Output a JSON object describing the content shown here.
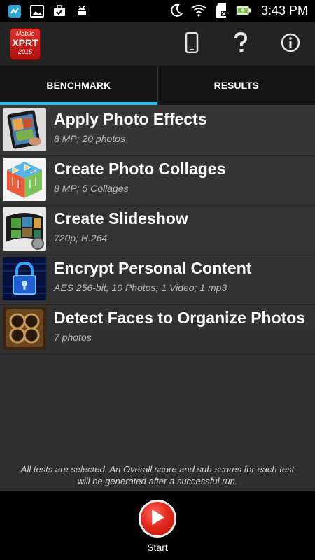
{
  "status_bar": {
    "time": "3:43 PM",
    "icons": [
      "app-notification-icon",
      "image-icon",
      "briefcase-check-icon",
      "android-icon",
      "moon-icon",
      "wifi-icon",
      "sd-card-icon",
      "battery-charging-icon"
    ]
  },
  "action_bar": {
    "logo": {
      "line1": "Mobile",
      "line2": "XPRT",
      "line3": "2015"
    },
    "actions": [
      "device-icon",
      "help-icon",
      "info-icon"
    ]
  },
  "tabs": [
    {
      "label": "BENCHMARK",
      "active": true
    },
    {
      "label": "RESULTS",
      "active": false
    }
  ],
  "tests": [
    {
      "title": "Apply Photo Effects",
      "subtitle": "8 MP; 20 photos"
    },
    {
      "title": "Create Photo Collages",
      "subtitle": "8 MP; 5 Collages"
    },
    {
      "title": "Create Slideshow",
      "subtitle": "720p; H.264"
    },
    {
      "title": "Encrypt Personal Content",
      "subtitle": "AES 256-bit; 10 Photos; 1 Video; 1 mp3"
    },
    {
      "title": "Detect Faces to Organize Photos",
      "subtitle": "7 photos"
    }
  ],
  "note": {
    "line1": "All tests are selected. An Overall score and sub-scores for each test",
    "line2": "will be generated after a successful run."
  },
  "start": {
    "label": "Start"
  },
  "colors": {
    "accent": "#33b5e5",
    "start_red": "#e42a1e",
    "logo_red": "#d01f18"
  }
}
